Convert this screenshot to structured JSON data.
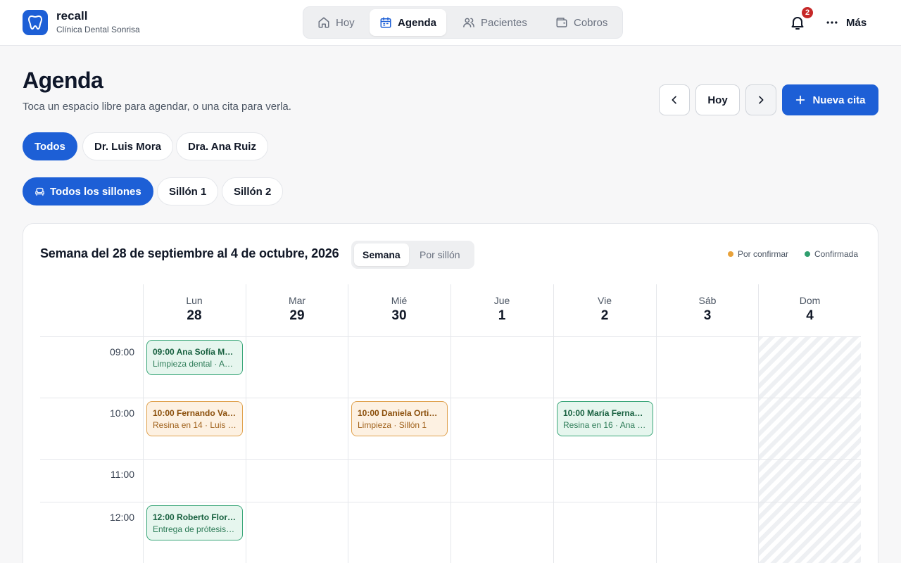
{
  "brand": {
    "name": "recall",
    "clinic": "Clínica Dental Sonrisa"
  },
  "nav": [
    {
      "label": "Hoy",
      "icon": "home-icon",
      "active": false
    },
    {
      "label": "Agenda",
      "icon": "calendar-icon",
      "active": true
    },
    {
      "label": "Pacientes",
      "icon": "users-icon",
      "active": false
    },
    {
      "label": "Cobros",
      "icon": "wallet-icon",
      "active": false
    }
  ],
  "header": {
    "notifications_count": "2",
    "more_label": "Más"
  },
  "page": {
    "title": "Agenda",
    "subtitle": "Toca un espacio libre para agendar, o una cita para verla.",
    "today_label": "Hoy",
    "new_label": "Nueva cita"
  },
  "doctor_filters": [
    {
      "label": "Todos",
      "active": true
    },
    {
      "label": "Dr. Luis Mora",
      "active": false
    },
    {
      "label": "Dra. Ana Ruiz",
      "active": false
    }
  ],
  "chair_filters": [
    {
      "label": "Todos los sillones",
      "active": true
    },
    {
      "label": "Sillón 1",
      "active": false
    },
    {
      "label": "Sillón 2",
      "active": false
    }
  ],
  "calendar": {
    "week_title": "Semana del 28 de septiembre al 4 de octubre, 2026",
    "views": [
      {
        "label": "Semana",
        "active": true
      },
      {
        "label": "Por sillón",
        "active": false
      }
    ],
    "legend": [
      {
        "label": "Por confirmar",
        "color": "#e8a23a"
      },
      {
        "label": "Confirmada",
        "color": "#2f9e6e"
      }
    ],
    "days": [
      {
        "name": "Lun",
        "num": "28"
      },
      {
        "name": "Mar",
        "num": "29"
      },
      {
        "name": "Mié",
        "num": "30"
      },
      {
        "name": "Jue",
        "num": "1"
      },
      {
        "name": "Vie",
        "num": "2"
      },
      {
        "name": "Sáb",
        "num": "3"
      },
      {
        "name": "Dom",
        "num": "4"
      }
    ],
    "hours": [
      "09:00",
      "10:00",
      "11:00",
      "12:00"
    ],
    "appointments": [
      {
        "title": "09:00 Ana Sofía M…",
        "detail": "Limpieza dental · A…",
        "status": "Confirmada"
      },
      {
        "title": "10:00 Fernando Va…",
        "detail": "Resina en 14 · Luis …",
        "status": "Por confirmar"
      },
      {
        "title": "10:00 Daniela Ortiz…",
        "detail": "Limpieza · Sillón 1",
        "status": "Por confirmar"
      },
      {
        "title": "10:00 María Ferna…",
        "detail": "Resina en 16 · Ana R…",
        "status": "Confirmada"
      },
      {
        "title": "12:00 Roberto Flor…",
        "detail": "Entrega de prótesis…",
        "status": "Confirmada"
      }
    ]
  }
}
